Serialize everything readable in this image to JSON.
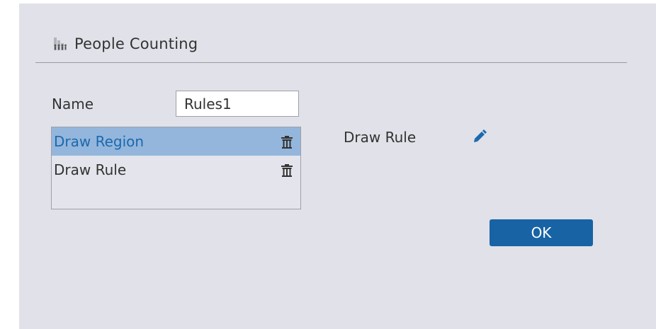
{
  "dialog": {
    "title": "People Counting",
    "title_icon": "people-counting-icon"
  },
  "form": {
    "name_label": "Name",
    "name_value": "Rules1"
  },
  "rules_list": {
    "items": [
      {
        "label": "Draw Region",
        "selected": true,
        "action_icon": "trash-icon"
      },
      {
        "label": "Draw Rule",
        "selected": false,
        "action_icon": "trash-icon"
      }
    ]
  },
  "detail": {
    "label": "Draw Rule",
    "edit_icon": "pencil-icon"
  },
  "buttons": {
    "ok_label": "OK"
  },
  "colors": {
    "background": "#e1e1e9",
    "selected_row": "#94b6dc",
    "selected_text": "#1c69ad",
    "accent": "#1763a4"
  }
}
